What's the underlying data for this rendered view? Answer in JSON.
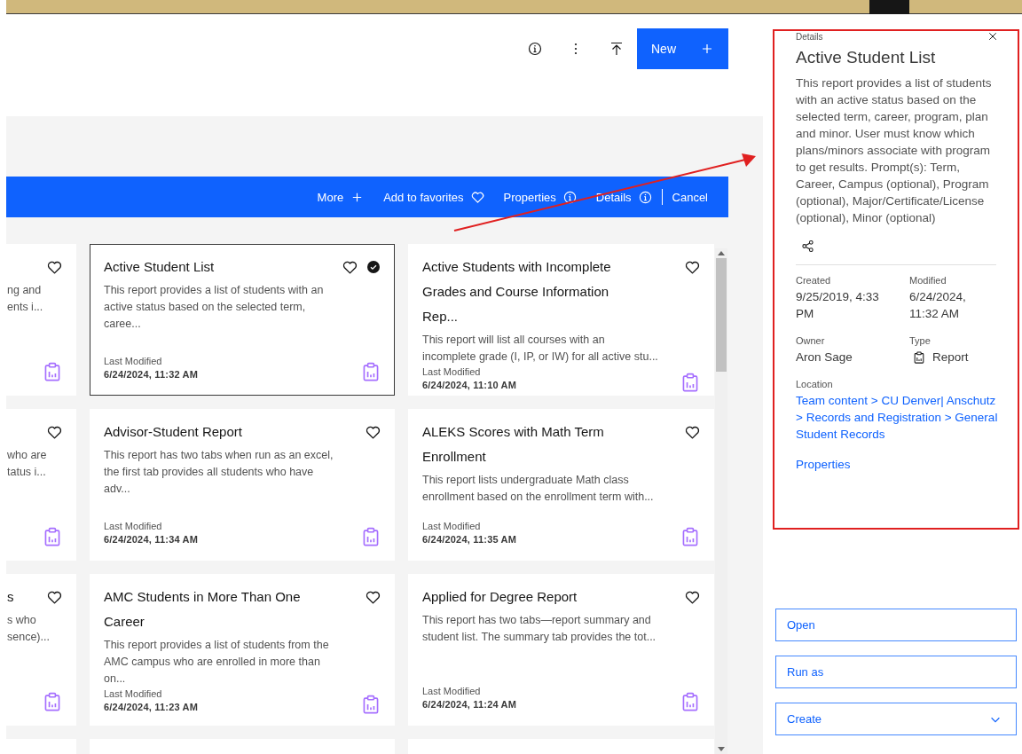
{
  "toolbar": {
    "icons": [
      {
        "kind": "info"
      },
      {
        "kind": "more"
      },
      {
        "kind": "upload"
      }
    ],
    "new_button": {
      "label": "New"
    }
  },
  "action_bar": {
    "actions": [
      {
        "label": "More",
        "kind": "add"
      },
      {
        "label": "Add to favorites",
        "kind": "favorite"
      },
      {
        "label": "Properties",
        "kind": "properties"
      },
      {
        "label": "Details",
        "kind": "details"
      },
      {
        "label": "Cancel",
        "kind": "cancel"
      }
    ]
  },
  "cards": [
    {
      "kind": "partial",
      "lines": [
        "ng and",
        "ents i..."
      ],
      "favorite": false,
      "selected": false
    },
    {
      "kind": "report",
      "title": "Active Student List",
      "description": "This report provides a list of students with an active status based on the selected term, caree...",
      "modified_label": "Last Modified",
      "modified": "6/24/2024, 11:32 AM",
      "favorite": false,
      "selected": true
    },
    {
      "kind": "report",
      "title": "Active Students with Incomplete Grades and Course Information Rep...",
      "description": "This report will list all courses with an incomplete grade (I, IP, or IW) for all active stu...",
      "modified_label": "Last Modified",
      "modified": "6/24/2024, 11:10 AM",
      "favorite": false,
      "selected": false
    },
    {
      "kind": "partial",
      "lines": [
        "who are",
        "tatus i..."
      ],
      "favorite": false,
      "selected": false
    },
    {
      "kind": "report",
      "title": "Advisor-Student Report",
      "description": "This report has two tabs when run as an excel, the first tab provides all students who have adv...",
      "modified_label": "Last Modified",
      "modified": "6/24/2024, 11:34 AM",
      "favorite": false,
      "selected": false
    },
    {
      "kind": "report",
      "title": "ALEKS Scores with Math Term Enrollment",
      "description": "This report lists undergraduate Math class enrollment based on the enrollment term with...",
      "modified_label": "Last Modified",
      "modified": "6/24/2024, 11:35 AM",
      "favorite": false,
      "selected": false
    },
    {
      "kind": "partial",
      "title": "s",
      "lines": [
        "s who",
        "sence)..."
      ],
      "favorite": false,
      "selected": false
    },
    {
      "kind": "report",
      "title": "AMC Students in More Than One Career",
      "description": "This report provides a list of students from the AMC campus who are enrolled in more than on...",
      "modified_label": "Last Modified",
      "modified": "6/24/2024, 11:23 AM",
      "favorite": false,
      "selected": false
    },
    {
      "kind": "report",
      "title": "Applied for Degree Report",
      "description": "This report has two tabs—report summary and student list. The summary tab provides the tot...",
      "modified_label": "Last Modified",
      "modified": "6/24/2024, 11:24 AM",
      "favorite": false,
      "selected": false
    },
    {
      "kind": "empty"
    },
    {
      "kind": "empty"
    },
    {
      "kind": "empty"
    }
  ],
  "details_panel": {
    "heading": "Details",
    "title": "Active Student List",
    "description": "This report provides a list of students with an active status based on the selected term, career, program, plan and minor. User must know which plans/minors associate with program to get results. Prompt(s): Term, Career, Campus (optional), Program (optional), Major/Certificate/License (optional), Minor (optional)",
    "fields": [
      {
        "label": "Created",
        "value": "9/25/2019, 4:33 PM",
        "kind": "text"
      },
      {
        "label": "Modified",
        "value": "6/24/2024, 11:32 AM",
        "kind": "text"
      },
      {
        "label": "Owner",
        "value": "Aron Sage",
        "kind": "text"
      },
      {
        "label": "Type",
        "value": "Report",
        "kind": "report"
      }
    ],
    "location_label": "Location",
    "location": "Team content > CU Denver| Anschutz > Records and Registration > General Student Records",
    "properties_link": "Properties",
    "buttons": [
      {
        "label": "Open",
        "kind": "plain"
      },
      {
        "label": "Run as",
        "kind": "plain"
      },
      {
        "label": "Create",
        "kind": "dropdown"
      }
    ]
  }
}
